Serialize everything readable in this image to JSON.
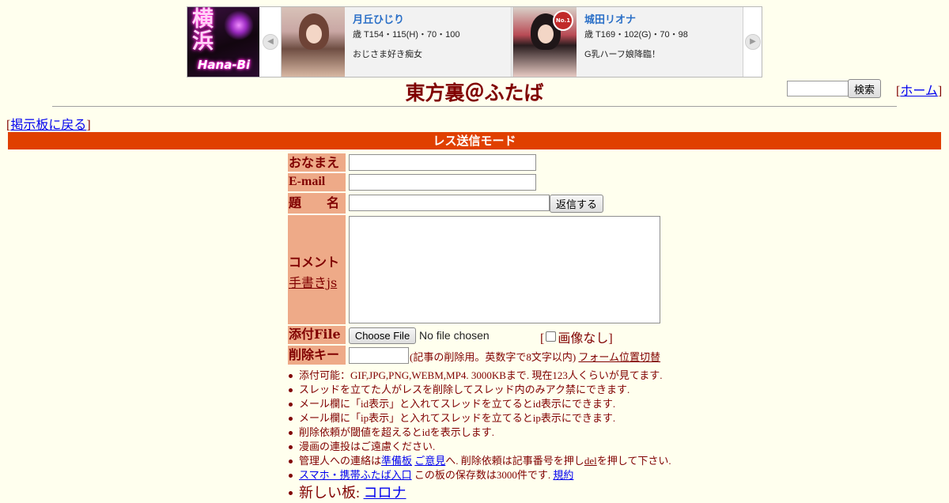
{
  "banner": {
    "logo_kanji": "横浜",
    "logo_text": "Hana-Bi",
    "cards": [
      {
        "name": "月丘ひじり",
        "stats": "歳 T154・115(H)・70・100",
        "desc": "おじさま好き痴女"
      },
      {
        "name": "城田リオナ",
        "stats": "歳 T169・102(G)・70・98",
        "desc": "G乳ハーフ娘降臨！",
        "badge": "No.1"
      }
    ],
    "prev_arrow": "◀",
    "next_arrow": "▶"
  },
  "header": {
    "title": "東方裏＠ふたば",
    "search_button": "検索",
    "home_link": "ホーム",
    "back_link": "掲示板に戻る"
  },
  "mode_bar": "レス送信モード",
  "form": {
    "name_label": "おなまえ",
    "email_label": "E-mail",
    "subject_label": "題　　名",
    "reply_button": "返信する",
    "comment_label": "コメント",
    "handwrite_link": "手書きjs",
    "file_label": "添付File",
    "file_button": "Choose File",
    "file_status": "No file chosen",
    "no_image_label": "画像なし",
    "delkey_label": "削除キー",
    "delkey_note": "(記事の削除用。英数字で8文字以内)",
    "form_toggle_link": "フォーム位置切替"
  },
  "notices": {
    "n1": "添付可能：GIF,JPG,PNG,WEBM,MP4. 3000KBまで. 現在123人くらいが見てます.",
    "n2": "スレッドを立てた人がレスを削除してスレッド内のみアク禁にできます.",
    "n3": "メール欄に「id表示」と入れてスレッドを立てるとid表示にできます.",
    "n4": "メール欄に「ip表示」と入れてスレッドを立てるとip表示にできます.",
    "n5": "削除依頼が閾値を超えるとidを表示します.",
    "n6": "漫画の連投はご遠慮ください.",
    "n7_pre": "管理人への連絡は",
    "n7_link1": "準備板",
    "n7_link2": "ご意見",
    "n7_mid": "へ. 削除依頼は記事番号を押し",
    "n7_link3": "del",
    "n7_post": "を押して下さい.",
    "n8_link1": "スマホ・携帯ふたば入口",
    "n8_mid": "この板の保存数は3000件です.",
    "n8_link2": "規約",
    "n9_pre": "新しい板: ",
    "n9_link": "コロナ"
  }
}
